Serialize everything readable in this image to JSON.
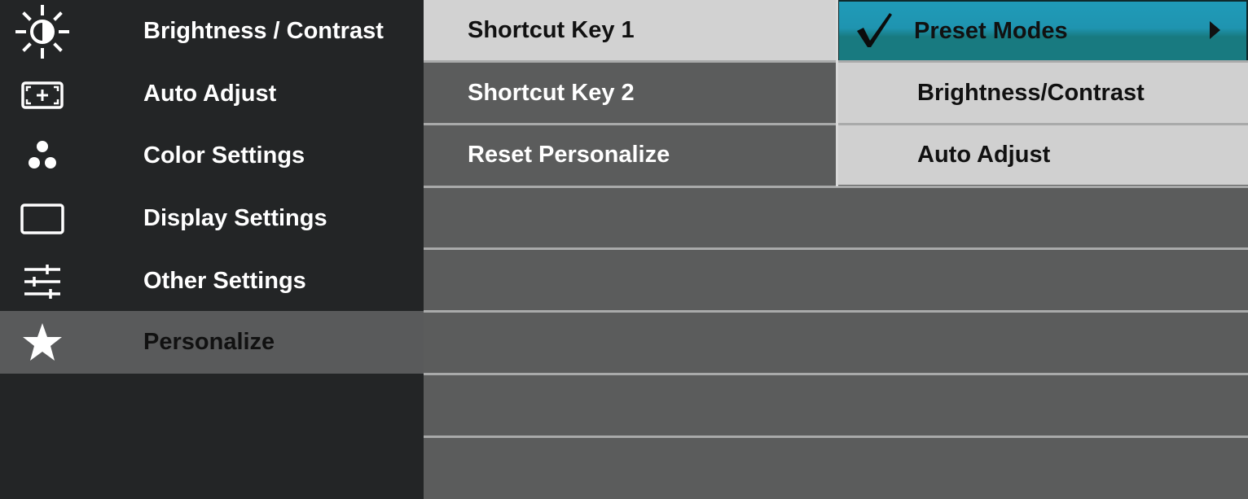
{
  "main_menu": {
    "items": [
      {
        "label": "Brightness / Contrast",
        "icon": "brightness-icon"
      },
      {
        "label": "Auto Adjust",
        "icon": "auto-adjust-icon"
      },
      {
        "label": "Color Settings",
        "icon": "color-settings-icon"
      },
      {
        "label": "Display Settings",
        "icon": "display-settings-icon"
      },
      {
        "label": "Other Settings",
        "icon": "sliders-icon"
      },
      {
        "label": "Personalize",
        "icon": "star-icon"
      }
    ],
    "selected": "Personalize"
  },
  "submenu": {
    "items": [
      {
        "label": "Shortcut Key 1"
      },
      {
        "label": "Shortcut Key 2"
      },
      {
        "label": "Reset Personalize"
      }
    ],
    "selected": "Shortcut Key 1"
  },
  "options": {
    "items": [
      {
        "label": "Preset Modes"
      },
      {
        "label": "Brightness/Contrast"
      },
      {
        "label": "Auto Adjust"
      }
    ],
    "selected": "Preset Modes",
    "check_icon": "checkmark-icon",
    "arrow_icon": "arrow-right-icon"
  },
  "colors": {
    "background": "#232526",
    "panel": "#5b5c5c",
    "highlight_teal": "#1f94b0",
    "selected_light": "#d2d2d2"
  }
}
